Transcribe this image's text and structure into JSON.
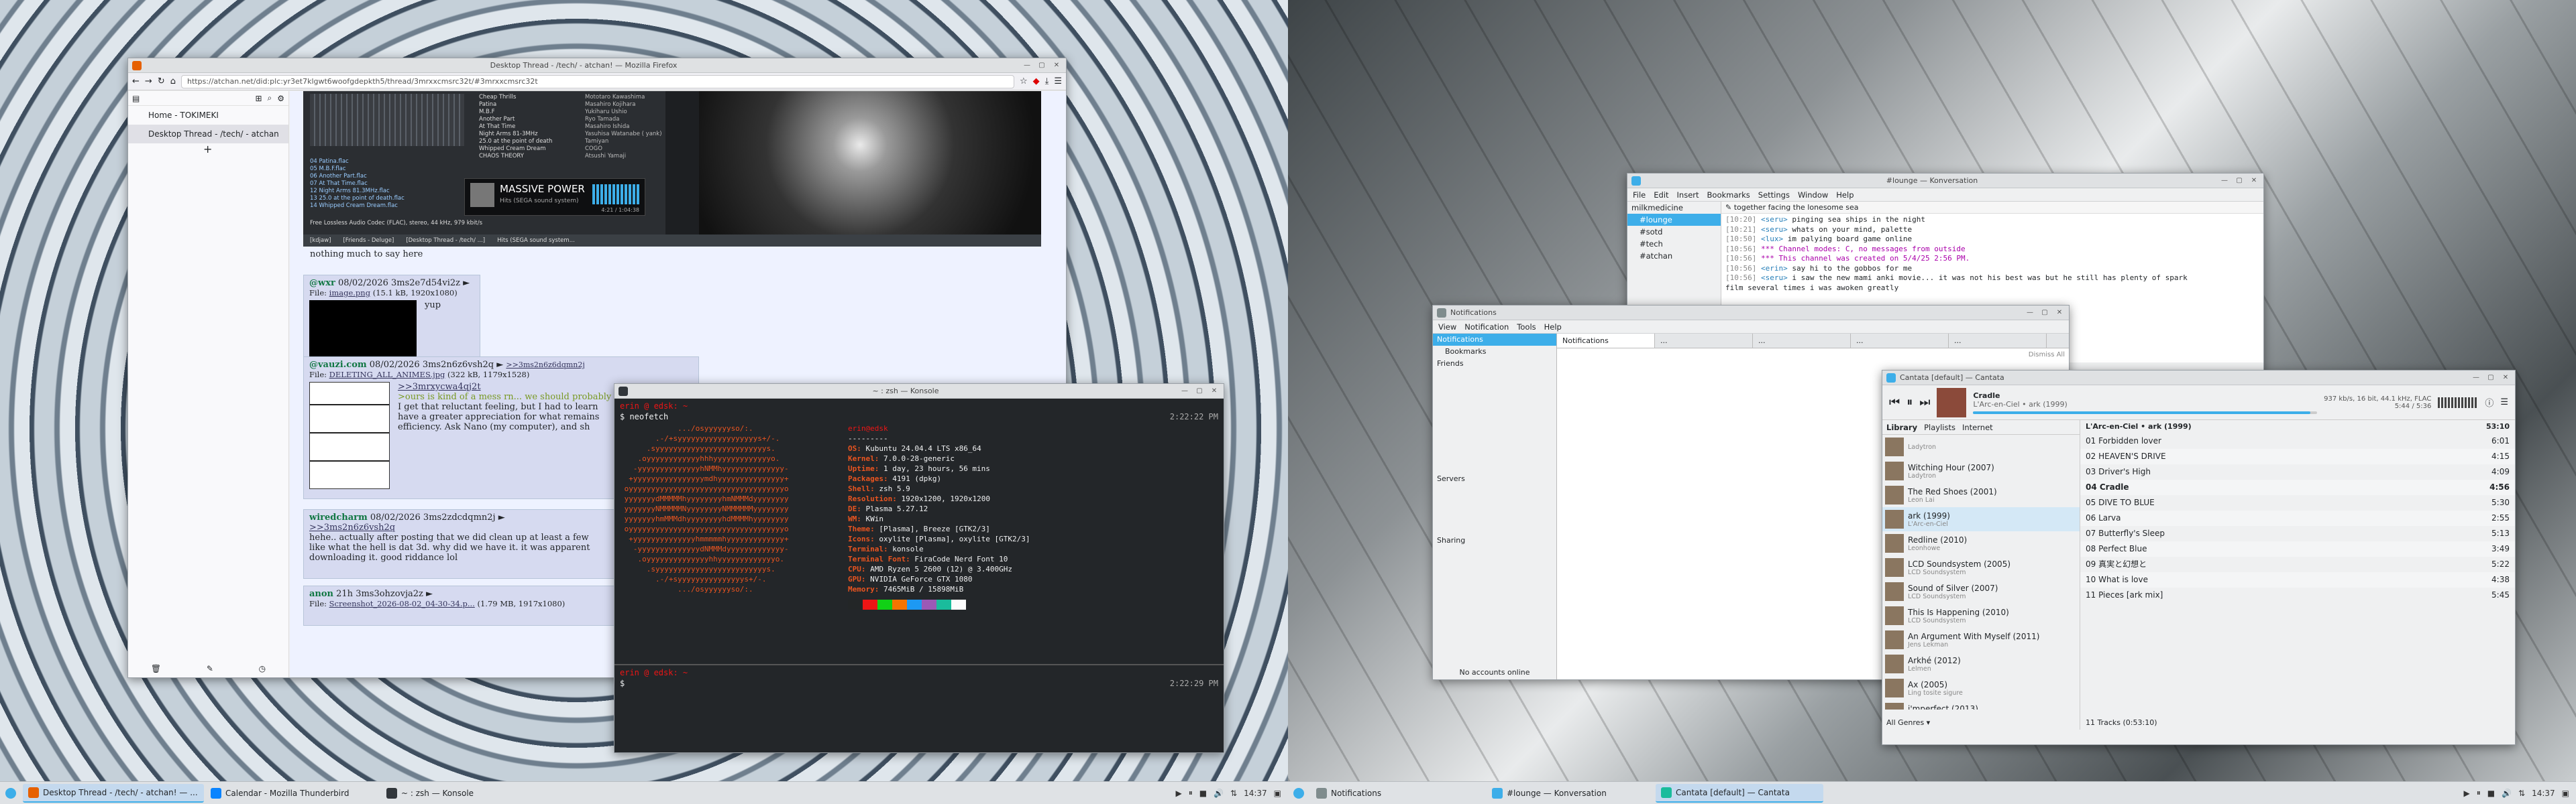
{
  "firefox": {
    "title": "Desktop Thread - /tech/ - atchan! — Mozilla Firefox",
    "url": "https://atchan.net/did:plc:yr3et7klgwt6woofgdepkth5/thread/3mrxxcmsrc32t/#3mrxxcmsrc32t",
    "side_home": "Home - TOKIMEKI",
    "side_thread": "Desktop Thread - /tech/ - atchan",
    "screenshot_lines": [
      "Cheap Thrills",
      "Patina",
      "M.B.F",
      "Another Part",
      "At That Time",
      "Night Arms 81-3MHz",
      "25.0 at the point of death",
      "Whipped Cream Dream",
      "CHAOS THEORY"
    ],
    "screenshot_artists": [
      "Mototaro Kawashima",
      "Masahiro Kojihara",
      "Yukiharu Ushio",
      "Ryo Tamada",
      "Masahiro Ishida",
      "Yasuhisa Watanabe ( yank)",
      "Tamiyan",
      "COGO",
      "Atsushi Yamaji"
    ],
    "screenshot_files": [
      "04 Patina.flac",
      "05 M.B.F.flac",
      "06 Another Part.flac",
      "07 At That Time.flac",
      "12 Night Arms 81.3MHz.flac",
      "13 25.0 at the point of death.flac",
      "14 Whipped Cream Dream.flac"
    ],
    "screenshot_status": "Free Lossless Audio Codec (FLAC), stereo, 44 kHz, 979 kbit/s",
    "screenshot_album": "MASSIVE POWER",
    "screenshot_album_sub": "Hits (SEGA sound system)",
    "screenshot_time": "4:21 / 1:04:38",
    "screenshot_bar": [
      "[kdjaw]",
      "[Friends - Deluge]",
      "[Desktop Thread - /tech/ ...]",
      "Hits (SEGA sound system..."
    ],
    "post0_text": "nothing much to say here",
    "post1_name": "@wxr",
    "post1_date": "08/02/2026 3ms2e7d54vi2z ►",
    "post1_file_label": "File:",
    "post1_file": "image.png",
    "post1_file_meta": "(15.1 kB, 1920x1080)",
    "post1_text": "yup",
    "post2_name": "@vauzi.com",
    "post2_date": "08/02/2026 3ms2n6z6vsh2q ►",
    "post2_backlink": ">>3ms2n6z6dqmn2j",
    "post2_file_label": "File:",
    "post2_file": "DELETING_ALL_ANIMES.jpg",
    "post2_file_meta": "(322 kB, 1179x1528)",
    "post2_quote": ">>3mrxycwa4qj2t",
    "post2_green": ">ours is kind of a mess rn... we should probably",
    "post2_l1": "I get that reluctant feeling, but I had to learn",
    "post2_l2": "have a greater appreciation for what remains",
    "post2_l3": "efficiency. Ask Nano (my computer), and sh",
    "post3_name": "wiredcharm",
    "post3_date": "08/02/2026 3ms2zdcdqmn2j ►",
    "post3_quote": ">>3ms2n6z6vsh2q",
    "post3_l1": "hehe.. actually after posting that we did clean up at least a few",
    "post3_l2": "like what the hell is dat 3d. why did we have it. it was apparent",
    "post3_l3": "downloading it. good riddance lol",
    "post4_name": "anon",
    "post4_date": "21h 3ms3ohzovja2z ►",
    "post4_file_label": "File:",
    "post4_file": "Screenshot_2026-08-02_04-30-34.p...",
    "post4_file_meta": "(1.79 MB, 1917x1080)"
  },
  "konsole": {
    "title": "~ : zsh — Konsole",
    "prompt1": "erin @ edsk: ~",
    "cmd1": "$ neofetch",
    "time1": "2:22:22 PM",
    "header": "erin@edsk",
    "sep": "---------",
    "info": [
      [
        "OS:",
        "Kubuntu 24.04.4 LTS x86_64"
      ],
      [
        "Kernel:",
        "7.0.0-28-generic"
      ],
      [
        "Uptime:",
        "1 day, 23 hours, 56 mins"
      ],
      [
        "Packages:",
        "4191 (dpkg)"
      ],
      [
        "Shell:",
        "zsh 5.9"
      ],
      [
        "Resolution:",
        "1920x1200, 1920x1200"
      ],
      [
        "DE:",
        "Plasma 5.27.12"
      ],
      [
        "WM:",
        "KWin"
      ],
      [
        "Theme:",
        "[Plasma], Breeze [GTK2/3]"
      ],
      [
        "Icons:",
        "oxylite [Plasma], oxylite [GTK2/3]"
      ],
      [
        "Terminal:",
        "konsole"
      ],
      [
        "Terminal Font:",
        "FiraCode Nerd Font 10"
      ],
      [
        "CPU:",
        "AMD Ryzen 5 2600 (12) @ 3.400GHz"
      ],
      [
        "GPU:",
        "NVIDIA GeForce GTX 1080"
      ],
      [
        "Memory:",
        "7465MiB / 15898MiB"
      ]
    ],
    "logo": [
      "             .../osyyyyyyso/:.",
      "        .-/+syyyyyyyyyyyyyyyyyys+/-.",
      "      .syyyyyyyyyyyyyyyyyyyyyyyyys.",
      "    .oyyyyyyyyyyyyhhhyyyyyyyyyyyyyo.",
      "   -yyyyyyyyyyyyyyhNMMhyyyyyyyyyyyyyy-",
      "  +yyyyyyyyyyyyyyyymdhyyyyyyyyyyyyyyy+",
      " oyyyyyyyyyyyyyyyyyyyyyyyyyyyyyyyyyyyo",
      " yyyyyyydMMMMMhyyyyyyyyhmNMMMdyyyyyyyy",
      " yyyyyyyNMMMMMNyyyyyyyyNMMMMMMyyyyyyyy",
      " yyyyyyyhmMMMdhyyyyyyyyhdMMMMhyyyyyyyy",
      " oyyyyyyyyyyyyyyyyyyyyyyyyyyyyyyyyyyyo",
      "  +yyyyyyyyyyyyyyhmmmmmhyyyyyyyyyyyyy+",
      "   -yyyyyyyyyyyyyydNMMMdyyyyyyyyyyyyy-",
      "    .oyyyyyyyyyyyyyyhhyyyyyyyyyyyyyo.",
      "      .syyyyyyyyyyyyyyyyyyyyyyyyys.",
      "        .-/+syyyyyyyyyyyyyyys+/-.",
      "             .../osyyyyyyso/:."
    ],
    "prompt2": "erin @ edsk: ~",
    "cmd2": "$ ",
    "time2": "2:22:29 PM"
  },
  "konversation": {
    "title": "#lounge — Konversation",
    "menu": [
      "File",
      "Edit",
      "Insert",
      "Bookmarks",
      "Settings",
      "Window",
      "Help"
    ],
    "server": "milkmedicine",
    "channels": [
      "#lounge",
      "#sotd",
      "#tech",
      "#atchan"
    ],
    "topic": "together facing the lonesome sea",
    "lines": [
      {
        "t": "[10:20]",
        "u": "<seru>",
        "m": "pinging sea ships in the night"
      },
      {
        "t": "[10:21]",
        "u": "<seru>",
        "m": "whats on your mind, palette"
      },
      {
        "t": "[10:50]",
        "u": "<lux>",
        "m": "im palying board game online"
      },
      {
        "t": "[10:56]",
        "u": "",
        "m": "*** Channel modes: C, no messages from outside"
      },
      {
        "t": "[10:56]",
        "u": "",
        "m": "*** This channel was created on 5/4/25 2:56 PM."
      },
      {
        "t": "[10:56]",
        "u": "<erin>",
        "m": "say hi to the gobbos for me"
      },
      {
        "t": "[10:56]",
        "u": "<seru>",
        "m": "i saw the new mami anki movie... it was not his best was but he still has plenty of spark"
      },
      {
        "t": "",
        "u": "",
        "m": "film several times i  was awoken greatly"
      }
    ]
  },
  "notifications": {
    "title": "Notifications",
    "menu": [
      "View",
      "Notification",
      "Tools",
      "Help"
    ],
    "tree": [
      "Notifications",
      "Bookmarks",
      "Friends"
    ],
    "servers_label": "Servers",
    "sharing_label": "Sharing",
    "status": "No accounts online",
    "tabs": [
      "Notifications",
      "...",
      "...",
      "...",
      "..."
    ],
    "dismiss": "Dismiss All"
  },
  "cantata": {
    "title": "Cantata [default] — Cantata",
    "track": "Cradle",
    "track_sub": "L'Arc-en-Ciel • ark (1999)",
    "format": "937 kb/s, 16 bit, 44.1 kHz, FLAC",
    "time": "5:44 / 5:36",
    "tabs": [
      "Library",
      "Playlists",
      "Internet"
    ],
    "albums": [
      {
        "n": "",
        "a": "Ladytron"
      },
      {
        "n": "Witching Hour (2007)",
        "a": "Ladytron"
      },
      {
        "n": "The Red Shoes (2001)",
        "a": "Leon Lai"
      },
      {
        "n": "ark (1999)",
        "a": "L'Arc-en-Ciel"
      },
      {
        "n": "Redline (2010)",
        "a": "Leonhowe"
      },
      {
        "n": "LCD Soundsystem (2005)",
        "a": "LCD Soundsystem"
      },
      {
        "n": "Sound of Silver (2007)",
        "a": "LCD Soundsystem"
      },
      {
        "n": "This Is Happening (2010)",
        "a": "LCD Soundsystem"
      },
      {
        "n": "An Argument With Myself (2011)",
        "a": "Jens Lekman"
      },
      {
        "n": "Arkhé (2012)",
        "a": "Lelmen"
      },
      {
        "n": "Ax (2005)",
        "a": "Ling tosite sigure"
      },
      {
        "n": "i'mperfect (2013)",
        "a": "Ling tosite sigure"
      }
    ],
    "genres": "All Genres",
    "album_header": "L'Arc-en-Ciel • ark (1999)",
    "album_len": "53:10",
    "tracks": [
      {
        "n": "01 Forbidden lover",
        "l": "6:01"
      },
      {
        "n": "02 HEAVEN'S DRIVE",
        "l": "4:15"
      },
      {
        "n": "03 Driver's High",
        "l": "4:09"
      },
      {
        "n": "04 Cradle",
        "l": "4:56"
      },
      {
        "n": "05 DIVE TO BLUE",
        "l": "5:30"
      },
      {
        "n": "06 Larva",
        "l": "2:55"
      },
      {
        "n": "07 Butterfly's Sleep",
        "l": "5:13"
      },
      {
        "n": "08 Perfect Blue",
        "l": "3:49"
      },
      {
        "n": "09 真実と幻想と",
        "l": "5:22"
      },
      {
        "n": "10 What is love",
        "l": "4:38"
      },
      {
        "n": "11 Pieces [ark mix]",
        "l": "5:45"
      }
    ],
    "footer": "11 Tracks (0:53:10)"
  },
  "taskbar_left": {
    "items": [
      "Desktop Thread - /tech/ - atchan! — ...",
      "Calendar - Mozilla Thunderbird",
      "~ : zsh — Konsole"
    ],
    "clock": "14:37"
  },
  "taskbar_right": {
    "items": [
      "Notifications",
      "#lounge — Konversation",
      "Cantata [default] — Cantata"
    ],
    "clock": "14:37"
  },
  "colors": {
    "accent": "#3daee9",
    "neofetch_orange": "#e95420",
    "term_bg": "#232629"
  }
}
